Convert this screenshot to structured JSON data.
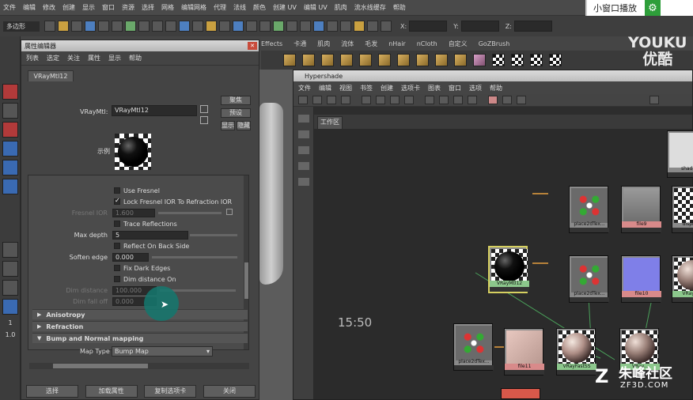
{
  "menubar": {
    "items": [
      "文件",
      "编辑",
      "修改",
      "创建",
      "显示",
      "窗口",
      "资源",
      "选择",
      "网格",
      "编辑网格",
      "代理",
      "法线",
      "颜色",
      "创建 UV",
      "编辑 UV",
      "肌肉",
      "流水线缓存",
      "帮助"
    ]
  },
  "pip": {
    "label": "小窗口播放"
  },
  "toolbar": {
    "mode": "多边形",
    "x_label": "X:",
    "y_label": "Y:",
    "z_label": "Z:"
  },
  "shelf": {
    "tabs": [
      "Effects",
      "卡通",
      "肌肉",
      "流体",
      "毛发",
      "nHair",
      "nCloth",
      "自定义",
      "GoZBrush"
    ]
  },
  "watermark_top": {
    "line1": "YOUKU",
    "line2": "优酷"
  },
  "left_strip": {
    "num1": "1",
    "num2": "1.0"
  },
  "attribute_editor": {
    "title": "属性编辑器",
    "menu": [
      "列表",
      "选定",
      "关注",
      "属性",
      "显示",
      "帮助"
    ],
    "tab": "VRayMtl12",
    "type_label": "VRayMtl:",
    "name_value": "VRayMtl12",
    "btn_focus": "聚焦",
    "btn_preset": "预设",
    "btn_show": "显示",
    "btn_hide": "隐藏",
    "swatch_label": "示例",
    "rows": {
      "use_fresnel": "Use Fresnel",
      "lock_fresnel": "Lock Fresnel IOR To Refraction IOR",
      "fresnel_ior_label": "Fresnel IOR",
      "fresnel_ior_value": "1.600",
      "trace_reflections": "Trace Reflections",
      "max_depth_label": "Max depth",
      "max_depth_value": "5",
      "reflect_back": "Reflect On Back Side",
      "soften_edge_label": "Soften edge",
      "soften_edge_value": "0.000",
      "fix_dark_edges": "Fix Dark Edges",
      "dim_distance_on": "Dim distance On",
      "dim_distance_label": "Dim distance",
      "dim_distance_value": "100.000",
      "dim_falloff_label": "Dim fall off",
      "dim_falloff_value": "0.000"
    },
    "sections": [
      "Anisotropy",
      "Refraction",
      "Bump and Normal mapping"
    ],
    "map_type_label": "Map Type",
    "map_type_value": "Bump Map",
    "buttons": [
      "选择",
      "加载属性",
      "复制选项卡",
      "关闭"
    ]
  },
  "hypershade": {
    "title": "Hypershade",
    "menu": [
      "文件",
      "编辑",
      "视图",
      "书签",
      "创建",
      "选项卡",
      "图表",
      "窗口",
      "选项",
      "帮助"
    ],
    "tab": "工作区",
    "time": "15:50",
    "nodes": [
      {
        "name": "shadi"
      },
      {
        "name": "place2dTex..."
      },
      {
        "name": "file9"
      },
      {
        "name": "displace"
      },
      {
        "name": "VRayMtl12"
      },
      {
        "name": "place2dTex..."
      },
      {
        "name": "file10"
      },
      {
        "name": "VRayB..."
      },
      {
        "name": "place2dTex..."
      },
      {
        "name": "file11"
      },
      {
        "name": "VRayFastSS"
      },
      {
        "name": "VRay..."
      }
    ]
  },
  "watermark_bottom": {
    "big": "朱峰社区",
    "small": "ZF3D.COM"
  }
}
